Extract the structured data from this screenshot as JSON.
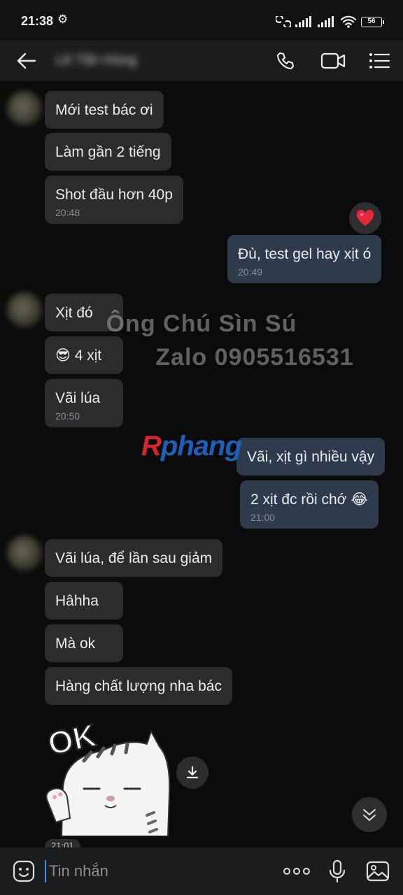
{
  "status_bar": {
    "time": "21:38",
    "battery": "56"
  },
  "header": {
    "contact_name": "Lê Tấn Hùng"
  },
  "chat": {
    "messages": [
      {
        "text": "Mới test bác ơi"
      },
      {
        "text": "Làm gần 2 tiếng"
      },
      {
        "text": "Shot đầu hơn 40p",
        "time": "20:48"
      },
      {
        "text": "Đù, test gel hay xịt ó",
        "time": "20:49"
      },
      {
        "text": "Xịt đó"
      },
      {
        "text": "😎 4 xịt"
      },
      {
        "text": "Vãi lúa",
        "time": "20:50"
      },
      {
        "text": "Vãi, xịt gì nhiều vậy"
      },
      {
        "text": "2 xịt đc rồi chớ 😂",
        "time": "21:00"
      },
      {
        "text": "Vãi lúa, để lần sau giảm"
      },
      {
        "text": "Hâhha"
      },
      {
        "text": "Mà ok"
      },
      {
        "text": "Hàng chất lượng nha bác"
      }
    ],
    "sticker_text": "OK",
    "sticker_time": "21:01",
    "watermark_line1": "Ông Chú Sìn Sú",
    "watermark_line2": "Zalo 0905516531",
    "logo_part1": "R",
    "logo_part2": "phang"
  },
  "input": {
    "placeholder": "Tin nhắn"
  }
}
